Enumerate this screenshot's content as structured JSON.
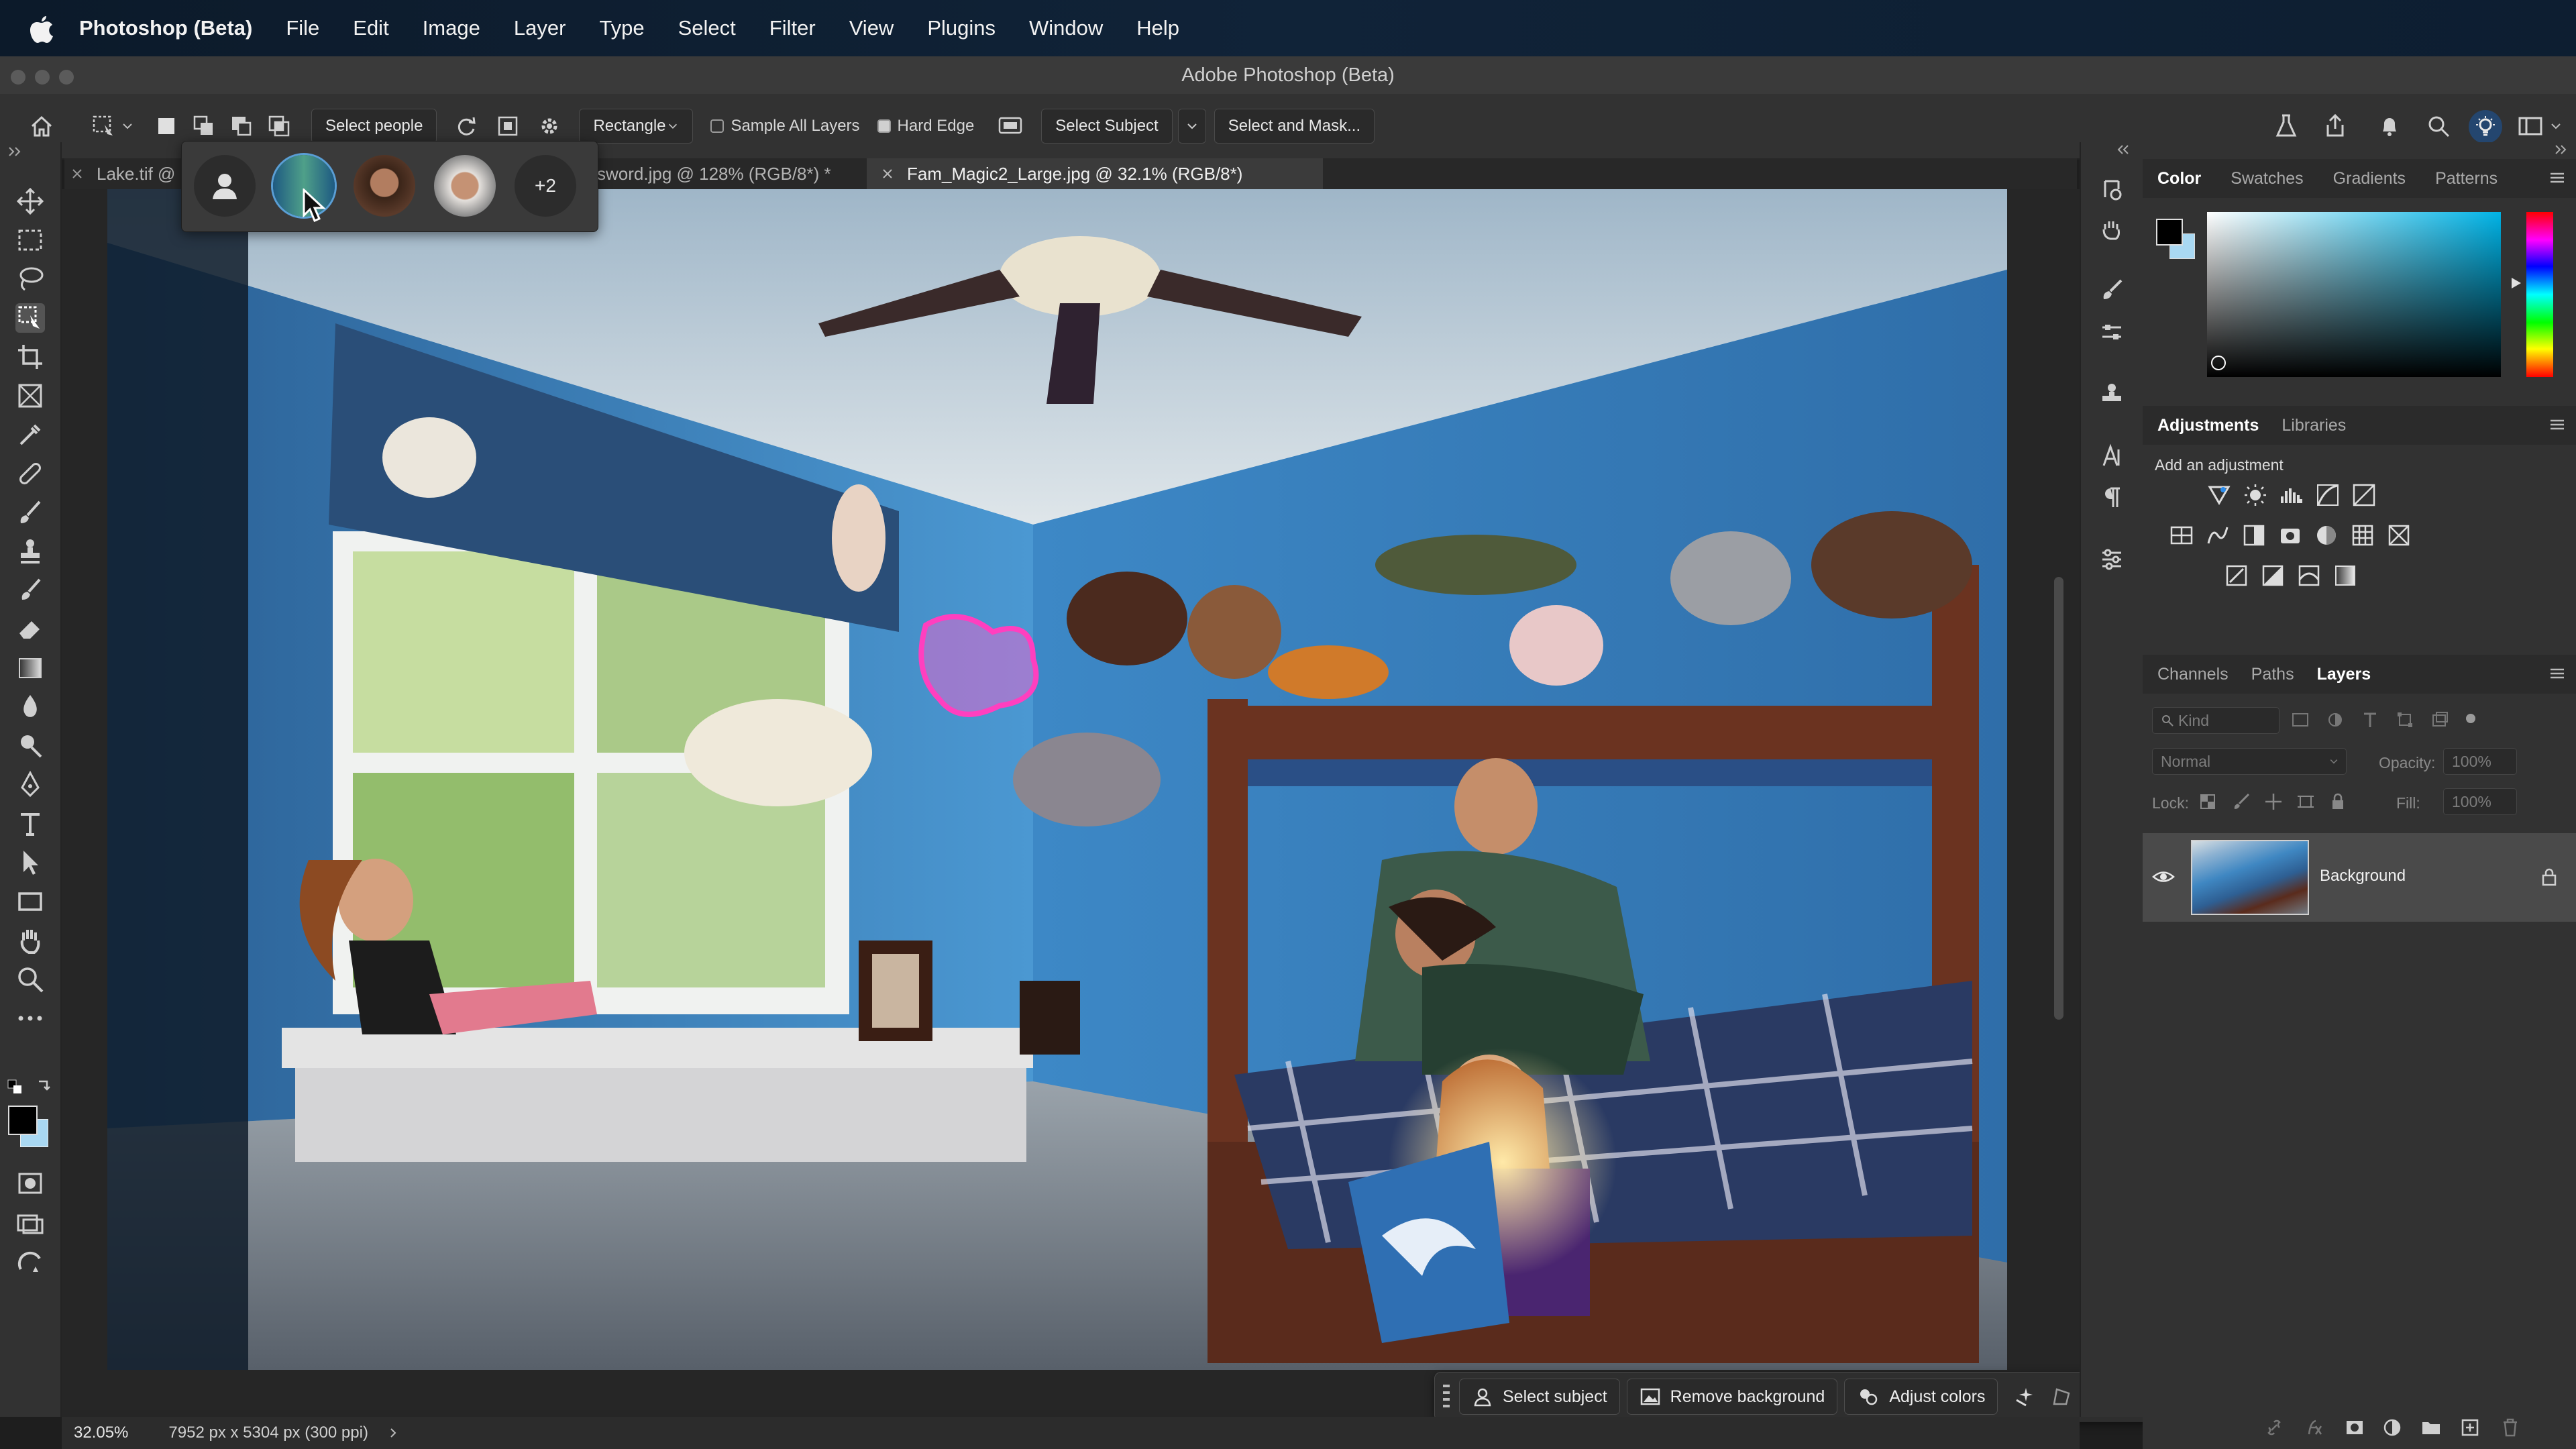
{
  "menubar": {
    "app_name": "Photoshop (Beta)",
    "items": [
      "File",
      "Edit",
      "Image",
      "Layer",
      "Type",
      "Select",
      "Filter",
      "View",
      "Plugins",
      "Window",
      "Help"
    ]
  },
  "window": {
    "title": "Adobe Photoshop (Beta)"
  },
  "options": {
    "select_people": "Select people",
    "mode": "Rectangle",
    "sample_all_layers": "Sample All Layers",
    "hard_edge": "Hard Edge",
    "select_subject": "Select Subject",
    "select_and_mask": "Select and Mask..."
  },
  "tabs": [
    {
      "label": "Lake.tif @"
    },
    {
      "label": "sword.jpg @ 128% (RGB/8*) *"
    },
    {
      "label": "Fam_Magic2_Large.jpg @ 32.1% (RGB/8*)"
    }
  ],
  "people_popup": {
    "more_label": "+2"
  },
  "status": {
    "zoom": "32.05%",
    "dimensions": "7952 px x 5304 px (300 ppi)"
  },
  "taskbar": {
    "select_subject": "Select subject",
    "remove_background": "Remove background",
    "adjust_colors": "Adjust colors"
  },
  "color_panel": {
    "tabs": [
      "Color",
      "Swatches",
      "Gradients",
      "Patterns"
    ],
    "foreground": "#000000",
    "background": "#a9d8f2"
  },
  "adjustments_panel": {
    "tabs": [
      "Adjustments",
      "Libraries"
    ],
    "subtitle": "Add an adjustment"
  },
  "layers_panel": {
    "tabs": [
      "Channels",
      "Paths",
      "Layers"
    ],
    "kind": "Kind",
    "blend_mode": "Normal",
    "opacity_label": "Opacity:",
    "opacity_value": "100%",
    "lock_label": "Lock:",
    "fill_label": "Fill:",
    "fill_value": "100%",
    "layer_name": "Background"
  },
  "colors": {
    "selection_highlight": "#ff3fbf",
    "accent": "#2d8ceb"
  }
}
